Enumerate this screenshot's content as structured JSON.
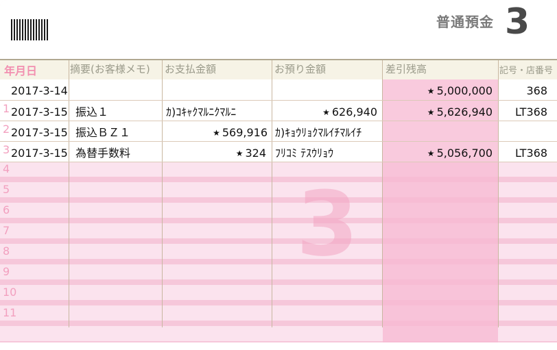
{
  "header": {
    "account_type": "普通預金",
    "book_number": "3"
  },
  "columns": {
    "date": "年月日",
    "memo": "摘要(お客様メモ)",
    "withdrawal": "お支払金額",
    "deposit": "お預り金額",
    "balance": "差引残高",
    "branch": "記号・店番号"
  },
  "line_numbers": [
    "1",
    "2",
    "3",
    "4",
    "5",
    "6",
    "7",
    "8",
    "9",
    "10",
    "11"
  ],
  "transactions": [
    {
      "date": "2017-3-14",
      "memo": "",
      "withdrawal": "",
      "deposit": "",
      "balance": "5,000,000",
      "branch": "368"
    },
    {
      "date": "2017-3-15",
      "memo": "振込１",
      "withdrawal": "ｶ)ｺｷｬｸﾏﾙﾆｸﾏﾙﾆ",
      "deposit": "626,940",
      "balance": "5,626,940",
      "branch": "LT368"
    },
    {
      "date": "2017-3-15",
      "memo": "振込ＢＺ１",
      "withdrawal": "569,916",
      "deposit": "ｶ)ｷｮｳﾘｮｸﾏﾙｲﾁﾏﾙｲﾁ",
      "balance": "",
      "branch": ""
    },
    {
      "date": "2017-3-15",
      "memo": "為替手数料",
      "withdrawal": "324",
      "deposit": "ﾌﾘｺﾐ ﾃｽｳﾘｮｳ",
      "balance": "5,056,700",
      "branch": "LT368"
    }
  ],
  "star_mark": "★"
}
